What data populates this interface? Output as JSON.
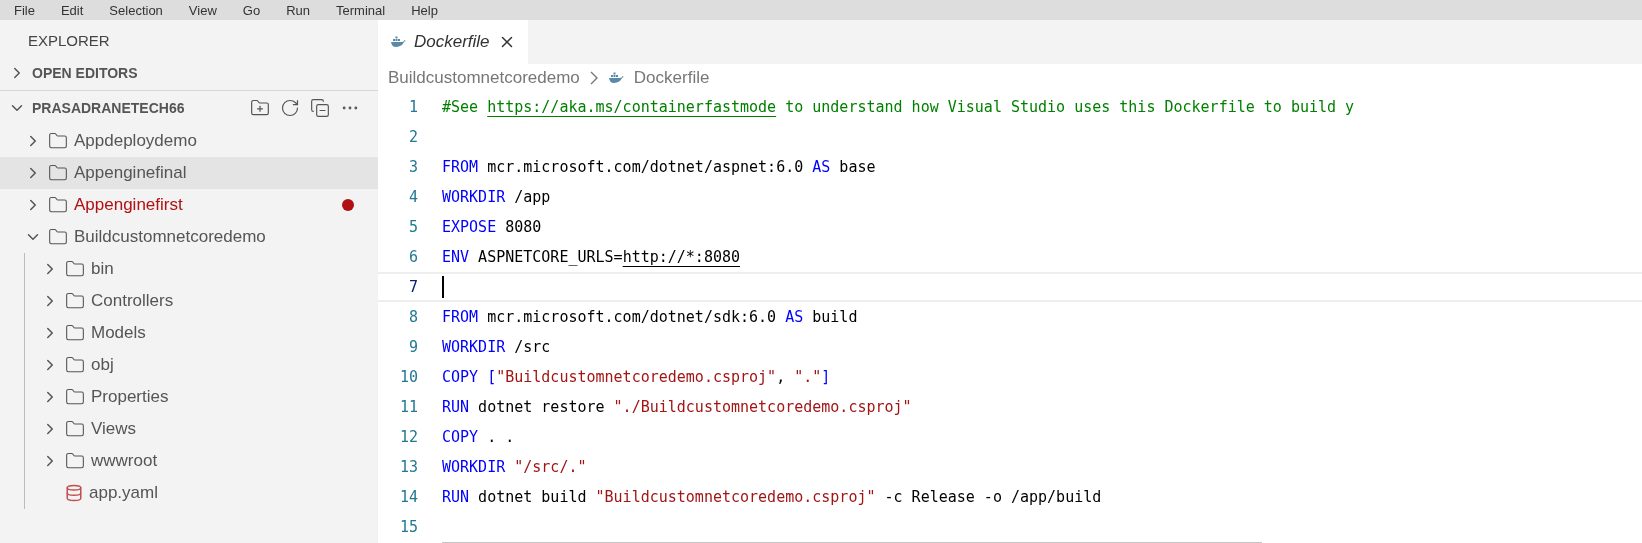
{
  "menu_bar": [
    "File",
    "Edit",
    "Selection",
    "View",
    "Go",
    "Run",
    "Terminal",
    "Help"
  ],
  "explorer": {
    "title": "EXPLORER",
    "sections": [
      {
        "label": "OPEN EDITORS",
        "expanded": false
      },
      {
        "label": "PRASADRANETECH66",
        "expanded": true
      }
    ],
    "tree": [
      {
        "label": "Appdeploydemo",
        "kind": "folder",
        "expanded": false,
        "selected": false,
        "modified": false
      },
      {
        "label": "Appenginefinal",
        "kind": "folder",
        "expanded": false,
        "selected": true,
        "modified": false
      },
      {
        "label": "Appenginefirst",
        "kind": "folder",
        "expanded": false,
        "selected": false,
        "modified": true
      },
      {
        "label": "Buildcustomnetcoredemo",
        "kind": "folder",
        "expanded": true,
        "selected": false,
        "modified": false,
        "children": [
          {
            "label": "bin",
            "kind": "folder",
            "expanded": false,
            "selected": false,
            "modified": false
          },
          {
            "label": "Controllers",
            "kind": "folder",
            "expanded": false,
            "selected": false,
            "modified": false
          },
          {
            "label": "Models",
            "kind": "folder",
            "expanded": false,
            "selected": false,
            "modified": false
          },
          {
            "label": "obj",
            "kind": "folder",
            "expanded": false,
            "selected": false,
            "modified": false
          },
          {
            "label": "Properties",
            "kind": "folder",
            "expanded": false,
            "selected": false,
            "modified": false
          },
          {
            "label": "Views",
            "kind": "folder",
            "expanded": false,
            "selected": false,
            "modified": false
          },
          {
            "label": "wwwroot",
            "kind": "folder",
            "expanded": false,
            "selected": false,
            "modified": false
          },
          {
            "label": "app.yaml",
            "kind": "yaml",
            "expanded": false,
            "selected": false,
            "modified": false
          }
        ]
      }
    ]
  },
  "tabs": [
    {
      "label": "Dockerfile",
      "selected": true,
      "preview": true
    }
  ],
  "breadcrumb": [
    "Buildcustomnetcoredemo",
    "Dockerfile"
  ],
  "code": [
    {
      "number": "1",
      "current": false,
      "tokens": [
        {
          "kind": "comment",
          "text": "#See "
        },
        {
          "kind": "link",
          "text": "https://aka.ms/containerfastmode"
        },
        {
          "kind": "comment",
          "text": " to understand how Visual Studio uses this Dockerfile to build y"
        }
      ]
    },
    {
      "number": "2",
      "current": false
    },
    {
      "number": "3",
      "current": false,
      "tokens": [
        {
          "kind": "kw",
          "text": "FROM"
        },
        {
          "kind": "text",
          "text": " mcr.microsoft.com/dotnet/aspnet:6.0 "
        },
        {
          "kind": "kw",
          "text": "AS"
        },
        {
          "kind": "text",
          "text": " base"
        }
      ]
    },
    {
      "number": "4",
      "current": false,
      "tokens": [
        {
          "kind": "kw",
          "text": "WORKDIR"
        },
        {
          "kind": "text",
          "text": " /app"
        }
      ]
    },
    {
      "number": "5",
      "current": false,
      "tokens": [
        {
          "kind": "kw",
          "text": "EXPOSE"
        },
        {
          "kind": "text",
          "text": " 8080"
        }
      ]
    },
    {
      "number": "6",
      "current": false,
      "tokens": [
        {
          "kind": "kw",
          "text": "ENV"
        },
        {
          "kind": "text",
          "text": " ASPNETCORE_URLS="
        },
        {
          "kind": "ulink",
          "text": "http://*:8080"
        }
      ]
    },
    {
      "number": "7",
      "current": true
    },
    {
      "number": "8",
      "current": false,
      "tokens": [
        {
          "kind": "kw",
          "text": "FROM"
        },
        {
          "kind": "text",
          "text": " mcr.microsoft.com/dotnet/sdk:6.0 "
        },
        {
          "kind": "kw",
          "text": "AS"
        },
        {
          "kind": "text",
          "text": " build"
        }
      ]
    },
    {
      "number": "9",
      "current": false,
      "tokens": [
        {
          "kind": "kw",
          "text": "WORKDIR"
        },
        {
          "kind": "text",
          "text": " /src"
        }
      ]
    },
    {
      "number": "10",
      "current": false,
      "tokens": [
        {
          "kind": "kw",
          "text": "COPY ["
        },
        {
          "kind": "str",
          "text": "\"Buildcustomnetcoredemo.csproj\""
        },
        {
          "kind": "text",
          "text": ", "
        },
        {
          "kind": "str",
          "text": "\".\""
        },
        {
          "kind": "kw",
          "text": "]"
        }
      ]
    },
    {
      "number": "11",
      "current": false,
      "tokens": [
        {
          "kind": "kw",
          "text": "RUN"
        },
        {
          "kind": "text",
          "text": " dotnet restore "
        },
        {
          "kind": "str",
          "text": "\"./Buildcustomnetcoredemo.csproj\""
        }
      ]
    },
    {
      "number": "12",
      "current": false,
      "tokens": [
        {
          "kind": "kw",
          "text": "COPY"
        },
        {
          "kind": "text",
          "text": " . ."
        }
      ]
    },
    {
      "number": "13",
      "current": false,
      "tokens": [
        {
          "kind": "kw",
          "text": "WORKDIR "
        },
        {
          "kind": "str",
          "text": "\"/src/.\""
        }
      ]
    },
    {
      "number": "14",
      "current": false,
      "tokens": [
        {
          "kind": "kw",
          "text": "RUN"
        },
        {
          "kind": "text",
          "text": " dotnet build "
        },
        {
          "kind": "str",
          "text": "\"Buildcustomnetcoredemo.csproj\""
        },
        {
          "kind": "text",
          "text": " -c Release -o /app/build"
        }
      ]
    },
    {
      "number": "15",
      "current": false
    }
  ]
}
